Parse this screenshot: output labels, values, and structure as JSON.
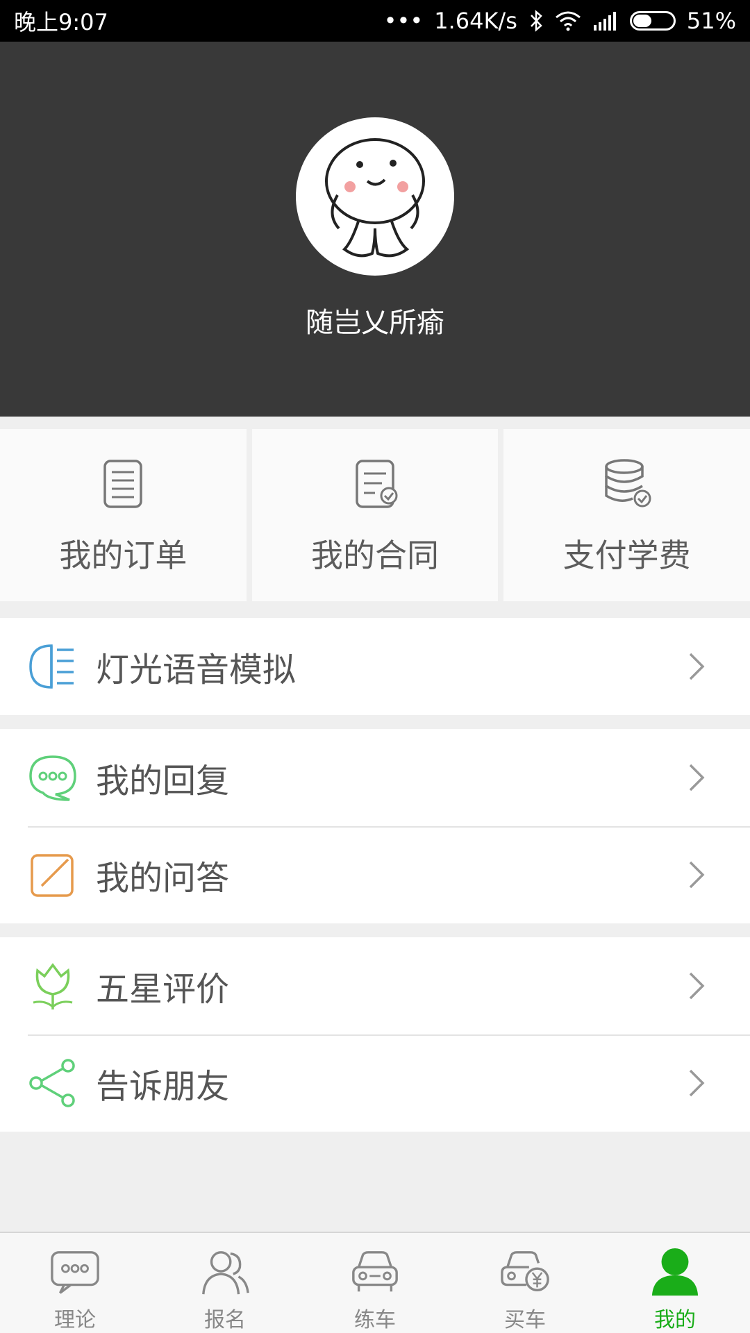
{
  "status_bar": {
    "time": "晚上9:07",
    "dots": "•••",
    "network_speed": "1.64K/s",
    "battery_percent": "51%",
    "battery_level": 0.51
  },
  "profile": {
    "username": "随岂乂所瘉"
  },
  "quick_actions": [
    {
      "label": "我的订单",
      "icon": "order-icon"
    },
    {
      "label": "我的合同",
      "icon": "contract-icon"
    },
    {
      "label": "支付学费",
      "icon": "payment-icon"
    }
  ],
  "menu": {
    "group1": [
      {
        "label": "灯光语音模拟",
        "icon": "headlight-icon",
        "color": "#4a9fd6"
      }
    ],
    "group2": [
      {
        "label": "我的回复",
        "icon": "chat-bubble-icon",
        "color": "#5fd07a"
      },
      {
        "label": "我的问答",
        "icon": "edit-icon",
        "color": "#e69a4c"
      }
    ],
    "group3": [
      {
        "label": "五星评价",
        "icon": "tulip-icon",
        "color": "#7bcf5b"
      },
      {
        "label": "告诉朋友",
        "icon": "share-icon",
        "color": "#5fd07a"
      }
    ]
  },
  "bottom_nav": {
    "active_color": "#1aad19",
    "tabs": [
      {
        "label": "理论",
        "icon": "chat-bubble-icon"
      },
      {
        "label": "报名",
        "icon": "people-icon"
      },
      {
        "label": "练车",
        "icon": "car-icon"
      },
      {
        "label": "买车",
        "icon": "car-yen-icon"
      },
      {
        "label": "我的",
        "icon": "user-icon",
        "active": true
      }
    ]
  }
}
